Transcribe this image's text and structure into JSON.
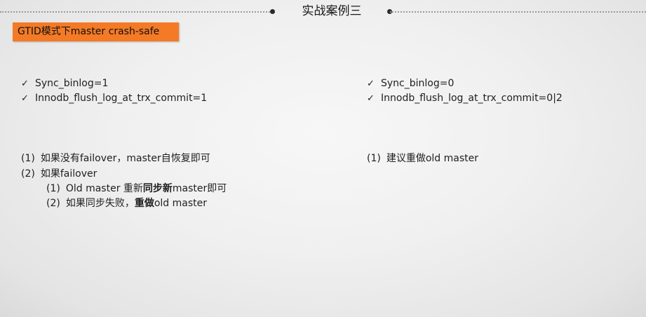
{
  "header": {
    "title": "实战案例三"
  },
  "tag": {
    "label": "GTID模式下master crash-safe"
  },
  "left": {
    "checks": [
      "Sync_binlog=1",
      "Innodb_flush_log_at_trx_commit=1"
    ],
    "steps": [
      {
        "num": "(1)",
        "text": "如果没有failover，master自恢复即可"
      },
      {
        "num": "(2)",
        "text": "如果failover"
      }
    ],
    "substeps": [
      {
        "num": "(1)",
        "parts": [
          "Old master 重新",
          "同步新",
          "master即可"
        ]
      },
      {
        "num": "(2)",
        "parts": [
          "如果同步失败，",
          "重做",
          "old master"
        ]
      }
    ]
  },
  "right": {
    "checks": [
      "Sync_binlog=0",
      "Innodb_flush_log_at_trx_commit=0|2"
    ],
    "steps": [
      {
        "num": "(1)",
        "text": "建议重做old master"
      }
    ]
  },
  "check_glyph": "✓",
  "colors": {
    "tag_bg": "#f47a26",
    "text": "#1e1e1e"
  }
}
